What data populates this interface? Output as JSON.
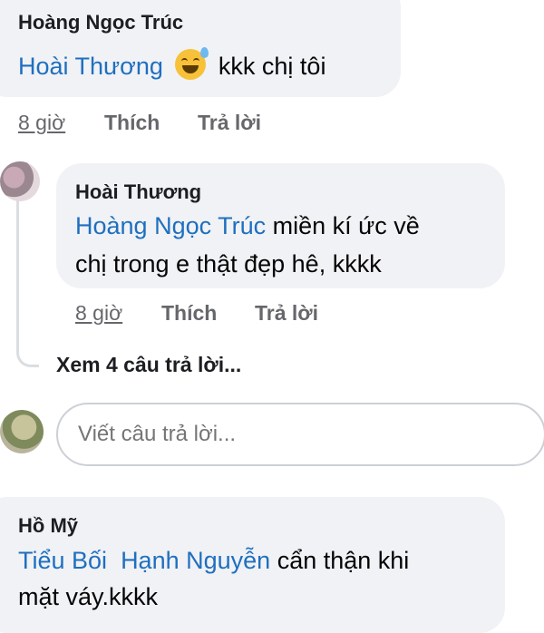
{
  "comment1": {
    "author": "Hoàng Ngọc Trúc",
    "mention": "Hoài Thương",
    "emoji_icon": "grinning-sweat-emoji",
    "text": "kkk chị tôi",
    "time": "8 giờ",
    "like": "Thích",
    "reply": "Trả lời"
  },
  "comment2": {
    "author": "Hoài Thương",
    "mention": "Hoàng Ngọc Trúc",
    "text_line1": " miền kí ức về",
    "text_line2": "chị trong e thật đẹp hê, kkkk",
    "time": "8 giờ",
    "like": "Thích",
    "reply": "Trả lời"
  },
  "view_replies": "Xem 4 câu trả lời...",
  "reply_input": {
    "placeholder": "Viết câu trả lời..."
  },
  "comment3": {
    "author": "Hồ Mỹ",
    "mention1": "Tiểu Bối",
    "mention2": "Hạnh Nguyễn",
    "text_line1": " cẩn thận khi",
    "text_line2": "mặt váy.kkkk"
  }
}
